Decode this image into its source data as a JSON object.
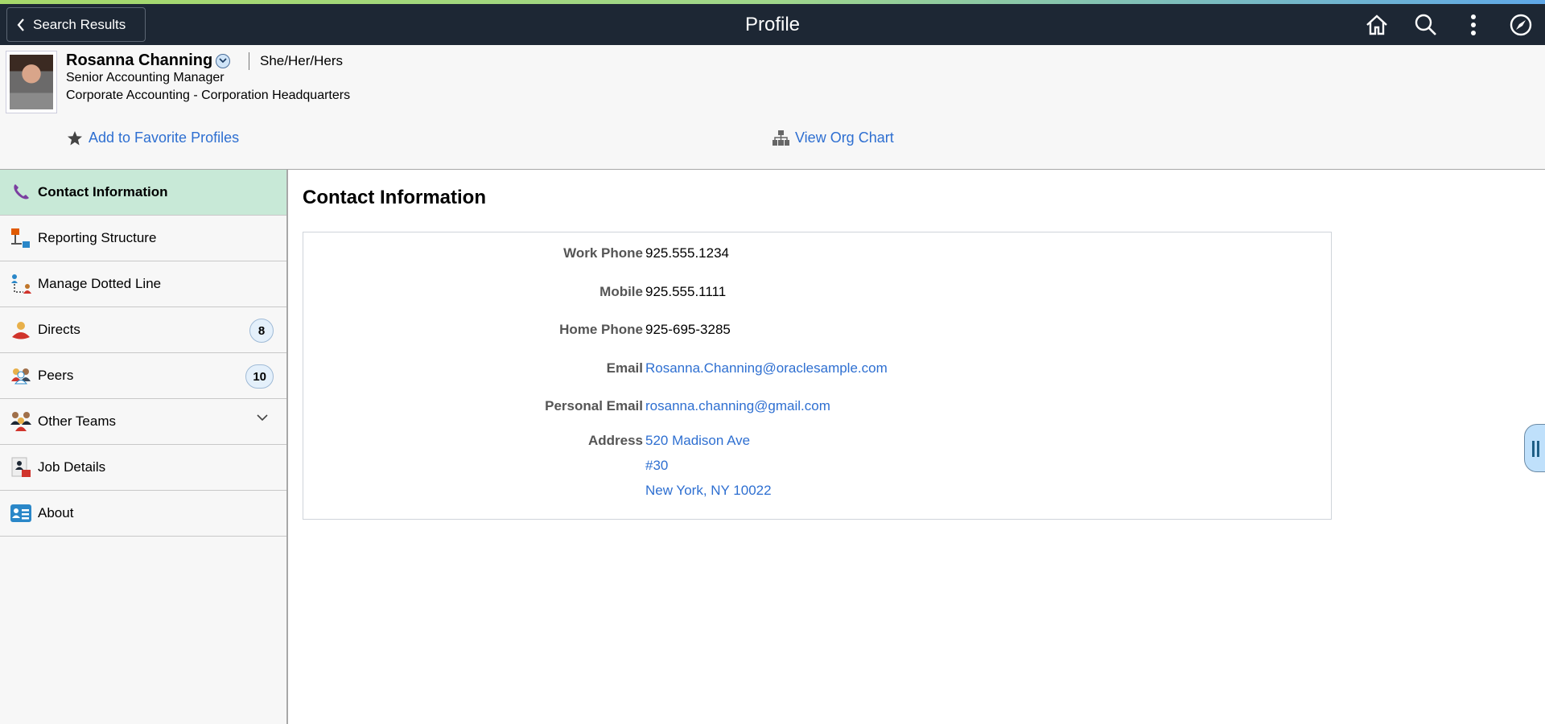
{
  "header": {
    "back_label": "Search Results",
    "title": "Profile",
    "icons": [
      "home-icon",
      "search-icon",
      "more-icon",
      "navigator-icon"
    ]
  },
  "profile": {
    "name": "Rosanna Channing",
    "pronouns": "She/Her/Hers",
    "title": "Senior Accounting Manager",
    "department": "Corporate Accounting - Corporation Headquarters",
    "favorite_label": "Add to Favorite Profiles",
    "org_chart_label": "View Org Chart"
  },
  "sidebar": {
    "items": [
      {
        "label": "Contact Information",
        "selected": true
      },
      {
        "label": "Reporting Structure"
      },
      {
        "label": "Manage Dotted Line"
      },
      {
        "label": "Directs",
        "count": "8"
      },
      {
        "label": "Peers",
        "count": "10"
      },
      {
        "label": "Other Teams"
      },
      {
        "label": "Job Details"
      },
      {
        "label": "About"
      }
    ]
  },
  "content": {
    "title": "Contact Information",
    "fields": [
      {
        "label": "Work Phone",
        "value": "925.555.1234"
      },
      {
        "label": "Mobile",
        "value": "925.555.1111"
      },
      {
        "label": "Home Phone",
        "value": "925-695-3285"
      },
      {
        "label": "Email",
        "value": "Rosanna.Channing@oraclesample.com"
      },
      {
        "label": "Personal Email",
        "value": "rosanna.channing@gmail.com"
      },
      {
        "label": "Address",
        "lines": [
          "520 Madison Ave",
          "#30",
          "New York, NY 10022"
        ]
      }
    ]
  },
  "colors": {
    "header": "#1d2734",
    "link": "#2e6fd1",
    "selected": "#c8e9d7"
  }
}
